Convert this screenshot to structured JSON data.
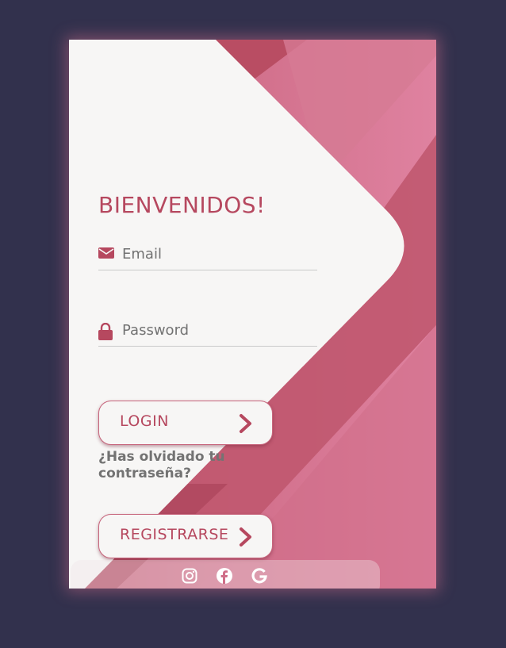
{
  "login_form": {
    "title": "BIENVENIDOS!",
    "email": {
      "placeholder": "Email",
      "icon": "envelope-icon"
    },
    "password": {
      "placeholder": "Password",
      "icon": "lock-icon"
    },
    "login_label": "LOGIN",
    "forgot_label": "¿Has olvidado tu contraseña?",
    "register_label": "REGISTRARSE"
  },
  "social": [
    {
      "name": "instagram-icon"
    },
    {
      "name": "facebook-icon"
    },
    {
      "name": "google-icon"
    }
  ],
  "colors": {
    "page_background": "#32314d",
    "card_light": "#f7f6f5",
    "accent": "#b6485f",
    "pink": "#d17089"
  }
}
